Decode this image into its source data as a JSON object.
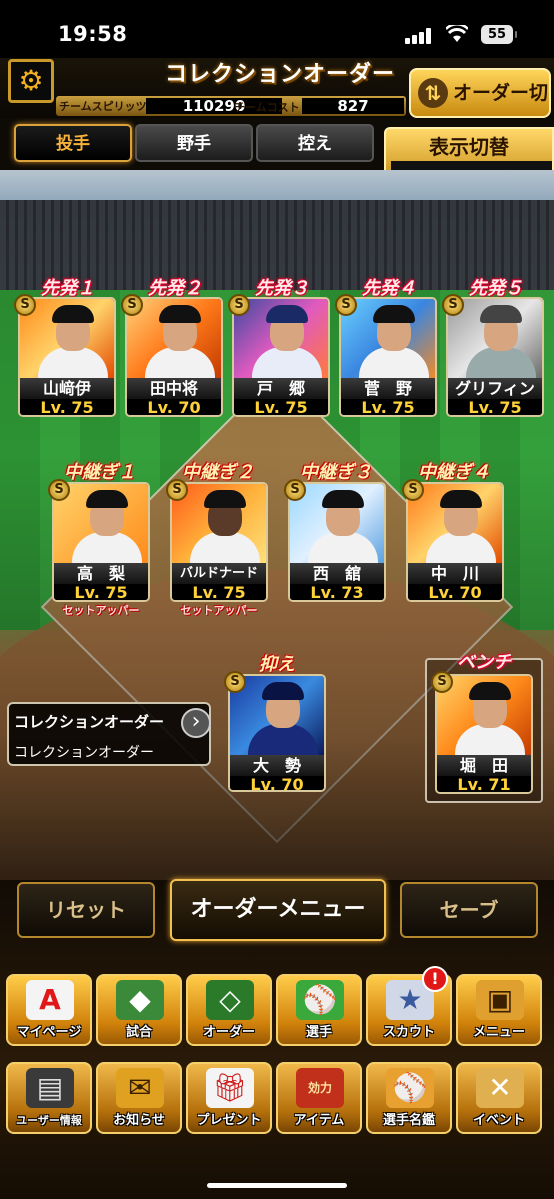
{
  "status_bar": {
    "time": "19:58",
    "battery": "55"
  },
  "header": {
    "title": "コレクションオーダー",
    "team_spirits_label": "チームスピリッツ",
    "team_spirits": "110290",
    "team_cost_label": "チームコスト",
    "team_cost": "827",
    "order_switch": "オーダー切替"
  },
  "tabs": [
    {
      "label": "投手",
      "active": true
    },
    {
      "label": "野手",
      "active": false
    },
    {
      "label": "控え",
      "active": false
    }
  ],
  "display_switch": {
    "label": "表示切替",
    "value": "−"
  },
  "starters": [
    {
      "position": "先発１",
      "name": "山﨑伊",
      "level": "Lv. 75"
    },
    {
      "position": "先発２",
      "name": "田中将",
      "level": "Lv. 70"
    },
    {
      "position": "先発３",
      "name": "戸　郷",
      "level": "Lv. 75"
    },
    {
      "position": "先発４",
      "name": "菅　野",
      "level": "Lv. 75"
    },
    {
      "position": "先発５",
      "name": "グリフィン",
      "level": "Lv. 75"
    }
  ],
  "relievers": [
    {
      "position": "中継ぎ１",
      "name": "高　梨",
      "level": "Lv. 75",
      "role": "セットアッパー"
    },
    {
      "position": "中継ぎ２",
      "name": "バルドナード",
      "level": "Lv. 75",
      "role": "セットアッパー"
    },
    {
      "position": "中継ぎ３",
      "name": "西　舘",
      "level": "Lv. 73",
      "role": ""
    },
    {
      "position": "中継ぎ４",
      "name": "中　川",
      "level": "Lv. 70",
      "role": ""
    }
  ],
  "closer": {
    "position": "抑え",
    "name": "大　勢",
    "level": "Lv. 70"
  },
  "bench": {
    "position": "ベンチ",
    "name": "堀　田",
    "level": "Lv. 71"
  },
  "collection_box": {
    "title": "コレクションオーダー",
    "value": "コレクションオーダー"
  },
  "buttons": {
    "reset": "リセット",
    "order_menu": "オーダーメニュー",
    "save": "セーブ"
  },
  "nav_row1": [
    {
      "label": "マイページ",
      "icon": "mypage-icon"
    },
    {
      "label": "試合",
      "icon": "game-icon"
    },
    {
      "label": "オーダー",
      "icon": "order-icon"
    },
    {
      "label": "選手",
      "icon": "player-icon"
    },
    {
      "label": "スカウト",
      "icon": "scout-icon",
      "badge": "!"
    },
    {
      "label": "メニュー",
      "icon": "menu-icon"
    }
  ],
  "nav_row2": [
    {
      "label": "ユーザー情報",
      "icon": "user-info-icon"
    },
    {
      "label": "お知らせ",
      "icon": "notice-icon"
    },
    {
      "label": "プレゼント",
      "icon": "present-icon"
    },
    {
      "label": "アイテム",
      "icon": "item-icon",
      "icon_text": "効力"
    },
    {
      "label": "選手名鑑",
      "icon": "player-book-icon"
    },
    {
      "label": "イベント",
      "icon": "event-icon"
    }
  ],
  "colors": {
    "accent": "#f2b120",
    "starter_red": "#e0002a",
    "level_yellow": "#ffd23a"
  }
}
